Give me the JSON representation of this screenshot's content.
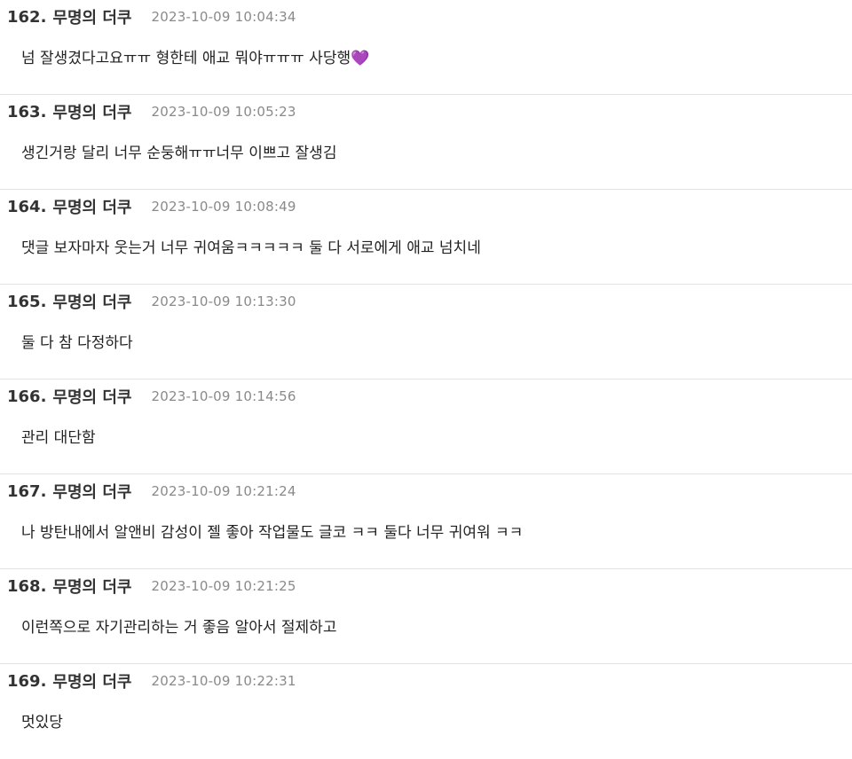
{
  "comments": [
    {
      "number": "162.",
      "author": "무명의 더쿠",
      "time": "2023-10-09 10:04:34",
      "text": "넘 잘생겼다고요ㅠㅠ 형한테 애교 뭐야ㅠㅠㅠ 사당행💜"
    },
    {
      "number": "163.",
      "author": "무명의 더쿠",
      "time": "2023-10-09 10:05:23",
      "text": "생긴거랑 달리 너무 순둥해ㅠㅠ너무 이쁘고 잘생김"
    },
    {
      "number": "164.",
      "author": "무명의 더쿠",
      "time": "2023-10-09 10:08:49",
      "text": "댓글 보자마자 웃는거 너무 귀여움ㅋㅋㅋㅋㅋ 둘 다 서로에게 애교 넘치네"
    },
    {
      "number": "165.",
      "author": "무명의 더쿠",
      "time": "2023-10-09 10:13:30",
      "text": "둘 다 참 다정하다"
    },
    {
      "number": "166.",
      "author": "무명의 더쿠",
      "time": "2023-10-09 10:14:56",
      "text": "관리 대단함"
    },
    {
      "number": "167.",
      "author": "무명의 더쿠",
      "time": "2023-10-09 10:21:24",
      "text": "나 방탄내에서 알앤비 감성이 젤 좋아 작업물도 글코 ㅋㅋ 둘다 너무 귀여워 ㅋㅋ"
    },
    {
      "number": "168.",
      "author": "무명의 더쿠",
      "time": "2023-10-09 10:21:25",
      "text": "이런쪽으로 자기관리하는 거 좋음 알아서 절제하고"
    },
    {
      "number": "169.",
      "author": "무명의 더쿠",
      "time": "2023-10-09 10:22:31",
      "text": "멋있당"
    }
  ]
}
